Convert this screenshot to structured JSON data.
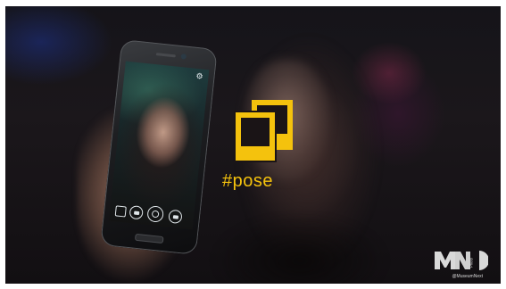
{
  "overlay": {
    "hashtag": "#pose",
    "icon": "photo-frames-icon",
    "accent_color": "#f4c20d"
  },
  "phone": {
    "screen_icons": [
      "gallery-thumbnail-icon",
      "mode-icon",
      "shutter-icon",
      "video-icon",
      "settings-icon"
    ]
  },
  "watermark": {
    "logo": "museum-next-logo",
    "vertical_text": "Photo",
    "handle": "@MuseumNext"
  }
}
